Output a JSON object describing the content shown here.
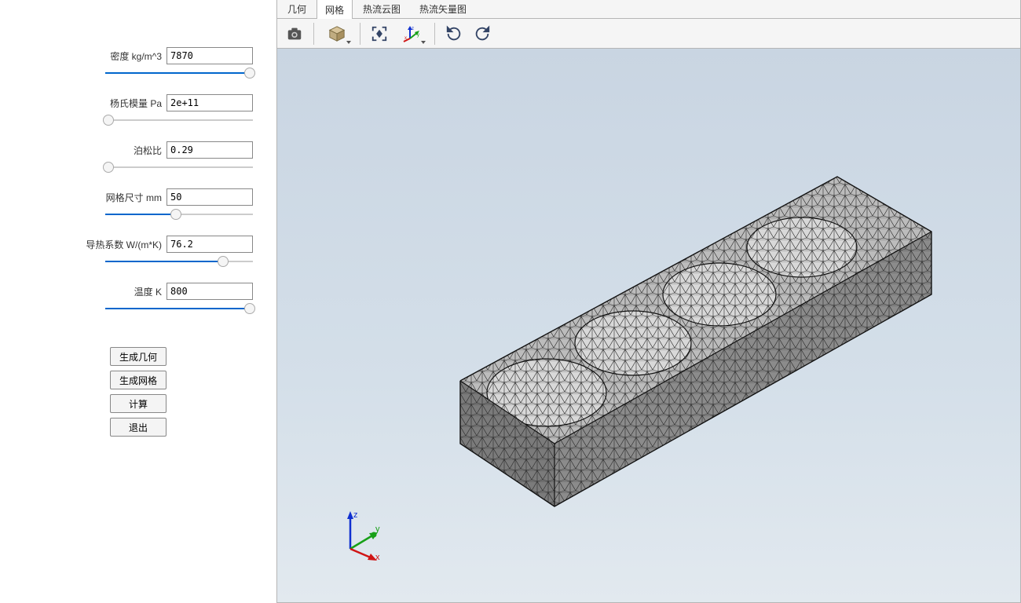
{
  "sidebar": {
    "params": [
      {
        "label": "密度 kg/m^3",
        "value": "7870",
        "pct": 98
      },
      {
        "label": "杨氏模量 Pa",
        "value": "2e+11",
        "pct": 2
      },
      {
        "label": "泊松比",
        "value": "0.29",
        "pct": 2
      },
      {
        "label": "网格尺寸 mm",
        "value": "50",
        "pct": 48
      },
      {
        "label": "导热系数 W/(m*K)",
        "value": "76.2",
        "pct": 80
      },
      {
        "label": "温度 K",
        "value": "800",
        "pct": 98
      }
    ],
    "buttons": {
      "gen_geom": "生成几何",
      "gen_mesh": "生成网格",
      "compute": "计算",
      "exit": "退出"
    }
  },
  "tabs": {
    "items": [
      "几何",
      "网格",
      "热流云图",
      "热流矢量图"
    ],
    "active_index": 1
  },
  "toolbar": {
    "icons": [
      "camera-icon",
      "cube-view-icon",
      "fit-view-icon",
      "axis-orient-icon",
      "rotate-ccw-icon",
      "rotate-cw-icon"
    ]
  },
  "triad": {
    "x": "x",
    "y": "y",
    "z": "z"
  },
  "colors": {
    "x_axis": "#d01515",
    "y_axis": "#18a018",
    "z_axis": "#1030d0",
    "slider_fill": "#0066cc"
  }
}
